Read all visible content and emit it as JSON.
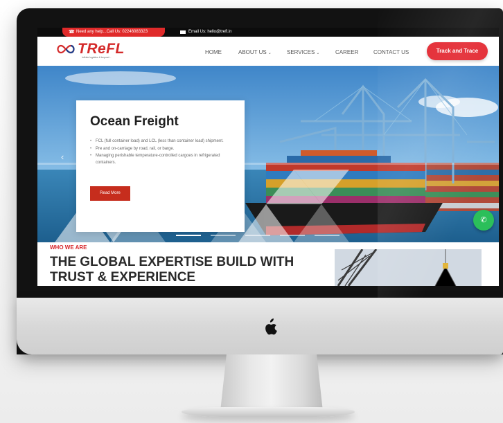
{
  "topbar": {
    "help_text": "Need any help...Call Us: 02246083323",
    "email_text": "Email Us: hello@trefl.in"
  },
  "brand": {
    "logo_text": "TReFL",
    "tagline": "Infinite logistics & beyond..."
  },
  "nav": {
    "items": [
      {
        "label": "HOME",
        "has_dropdown": false
      },
      {
        "label": "ABOUT US",
        "has_dropdown": true
      },
      {
        "label": "SERVICES",
        "has_dropdown": true
      },
      {
        "label": "CAREER",
        "has_dropdown": false
      },
      {
        "label": "CONTACT US",
        "has_dropdown": false
      }
    ],
    "cta_label": "Track and Trace"
  },
  "hero": {
    "title": "Ocean Freight",
    "bullets": [
      "FCL (full container load) and LCL (less than container load) shipment.",
      "Pre and on-carriage by road, rail, or barge.",
      "Managing perishable temperature-controlled cargoes in refrigerated containers."
    ],
    "button_label": "Read More",
    "slide_count": 5,
    "active_slide": 1
  },
  "section": {
    "label": "WHO WE ARE",
    "title": "THE GLOBAL EXPERTISE BUILD WITH TRUST & EXPERIENCE"
  },
  "colors": {
    "brand_red": "#e3262f",
    "button_red": "#c62d1d",
    "whatsapp_green": "#2bbf5a",
    "dark_bar": "#0c0c0c"
  },
  "icons": {
    "phone": "phone-icon",
    "mail": "mail-icon",
    "prev": "chevron-left-icon",
    "whatsapp": "whatsapp-icon",
    "apple": "apple-logo-icon"
  }
}
